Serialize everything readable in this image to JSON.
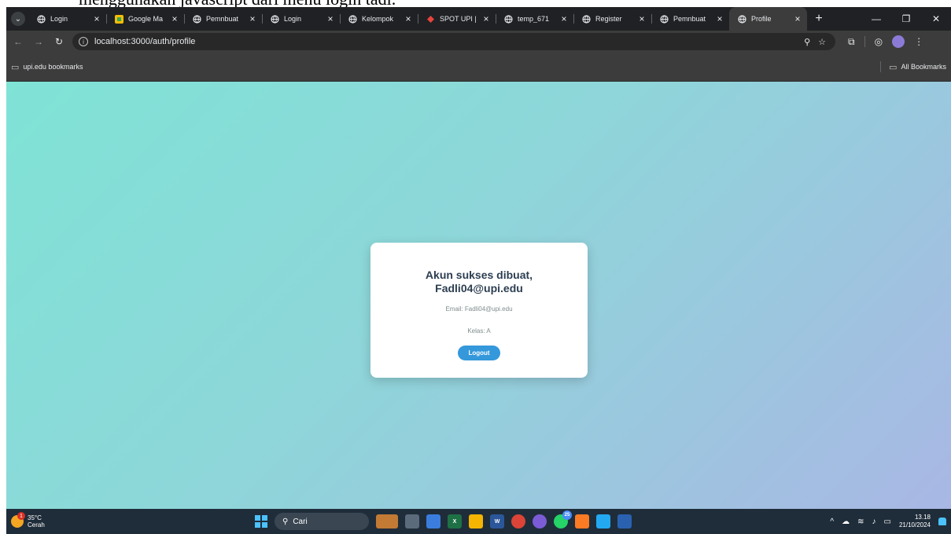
{
  "document": {
    "cutoff_text": "menggunakan javascript dari menu login tadi."
  },
  "browser": {
    "tabs": [
      {
        "title": "Login",
        "icon": "globe-icon",
        "active": false
      },
      {
        "title": "Google Ma",
        "icon": "google-maps-icon",
        "active": false
      },
      {
        "title": "Pemnbuat",
        "icon": "globe-icon",
        "active": false
      },
      {
        "title": "Login",
        "icon": "globe-icon",
        "active": false
      },
      {
        "title": "Kelompok",
        "icon": "globe-icon",
        "active": false
      },
      {
        "title": "SPOT UPI |",
        "icon": "upi-icon",
        "active": false
      },
      {
        "title": "temp_671",
        "icon": "globe-icon",
        "active": false
      },
      {
        "title": "Register",
        "icon": "globe-icon",
        "active": false
      },
      {
        "title": "Pemnbuat",
        "icon": "globe-icon",
        "active": false
      },
      {
        "title": "Profile",
        "icon": "globe-icon",
        "active": true
      }
    ],
    "url": "localhost:3000/auth/profile",
    "bookmarks": {
      "folder": "upi.edu bookmarks",
      "all": "All Bookmarks"
    }
  },
  "profile_card": {
    "title": "Akun sukses dibuat, Fadli04@upi.edu",
    "email": "Email: Fadli04@upi.edu",
    "kelas": "Kelas: A",
    "logout_label": "Logout"
  },
  "taskbar": {
    "weather_temp": "35°C",
    "weather_desc": "Cerah",
    "weather_badge": "1",
    "search_label": "Cari",
    "whatsapp_badge": "25",
    "time": "13.18",
    "date": "21/10/2024"
  },
  "colors": {
    "gradient_start": "#7fe3d6",
    "gradient_end": "#a9b7e4",
    "button": "#3498db",
    "title_text": "#2c3e50"
  }
}
